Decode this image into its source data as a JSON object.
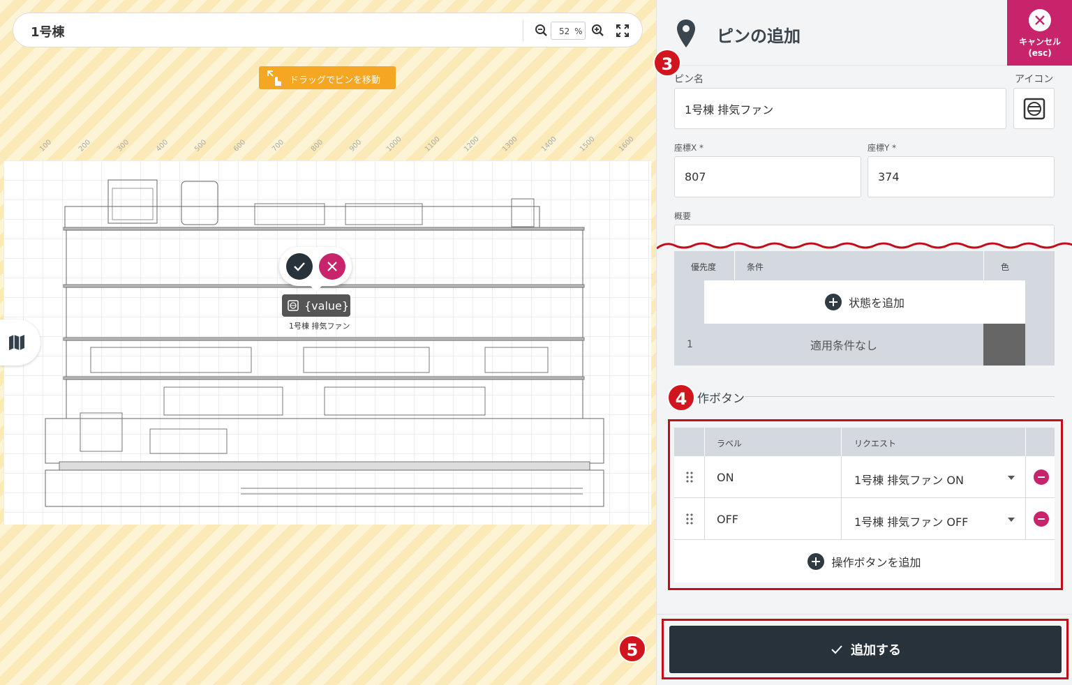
{
  "map": {
    "building_title": "1号棟",
    "zoom_value": "52",
    "zoom_unit": "%",
    "drag_hint": "ドラッグでピンを移動",
    "ruler_ticks": [
      "100",
      "200",
      "300",
      "400",
      "500",
      "600",
      "700",
      "800",
      "900",
      "1000",
      "1100",
      "1200",
      "1300",
      "1400",
      "1500",
      "1600"
    ],
    "pin_chip_text": "{value}",
    "pin_caption": "1号棟 排気ファン"
  },
  "panel": {
    "title": "ピンの追加",
    "cancel_label": "キャンセル\n(esc)",
    "pin_name_label": "ピン名",
    "pin_name_value": "1号棟 排気ファン",
    "icon_label": "アイコン",
    "coord_x_label": "座標X *",
    "coord_x_value": "807",
    "coord_y_label": "座標Y *",
    "coord_y_value": "374",
    "summary_label": "概要"
  },
  "states": {
    "headers": {
      "priority": "優先度",
      "condition": "条件",
      "color": "色"
    },
    "add_label": "状態を追加",
    "rows": [
      {
        "priority": "1",
        "condition": "適用条件なし",
        "color": "#666666"
      }
    ]
  },
  "operations": {
    "section_title": "作ボタン",
    "headers": {
      "label": "ラベル",
      "request": "リクエスト"
    },
    "rows": [
      {
        "label": "ON",
        "request": "1号棟 排気ファン ON"
      },
      {
        "label": "OFF",
        "request": "1号棟 排気ファン OFF"
      }
    ],
    "add_label": "操作ボタンを追加"
  },
  "submit_label": "追加する",
  "callouts": {
    "c3": "3",
    "c4": "4",
    "c5": "5"
  },
  "colors": {
    "accent": "#c8246b",
    "dark": "#28323a",
    "callout": "#d2141e",
    "hint": "#f5a623"
  }
}
